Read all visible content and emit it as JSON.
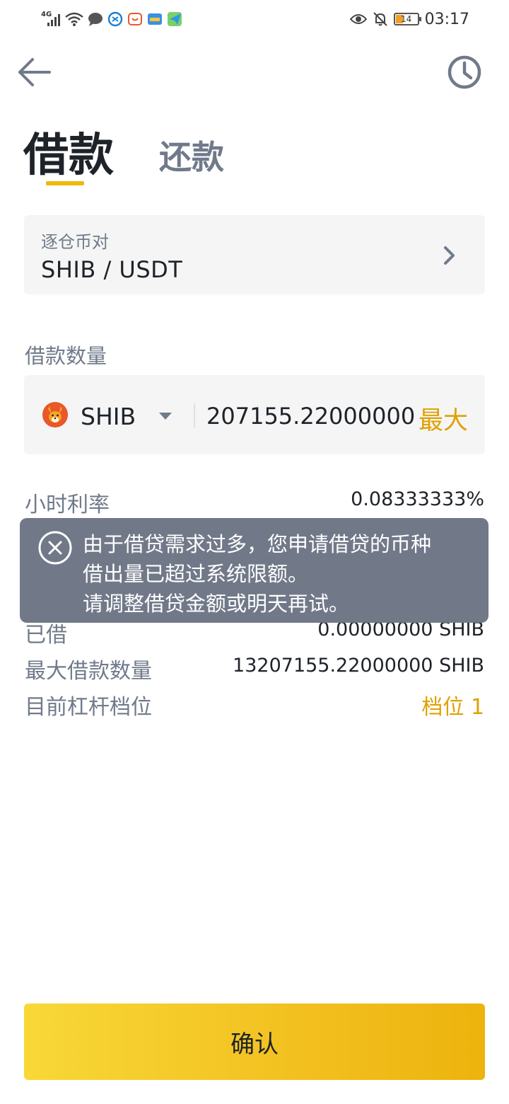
{
  "status_bar": {
    "network": "4G",
    "battery": "14",
    "time": "03:17"
  },
  "tabs": [
    {
      "label": "借款",
      "active": true
    },
    {
      "label": "还款",
      "active": false
    }
  ],
  "pair": {
    "label": "逐仓币对",
    "value": "SHIB / USDT"
  },
  "amount": {
    "label": "借款数量",
    "coin": "SHIB",
    "value": "207155.22000000",
    "max_label": "最大"
  },
  "info": {
    "hourly_rate_label": "小时利率",
    "hourly_rate_value": "0.08333333%",
    "borrowed_label": "已借",
    "borrowed_value": "0.00000000 SHIB",
    "max_borrow_label": "最大借款数量",
    "max_borrow_value": "13207155.22000000 SHIB",
    "leverage_label": "目前杠杆档位",
    "leverage_value": "档位 1"
  },
  "toast": {
    "line1": "由于借贷需求过多，您申请借贷的币种",
    "line2": "借出量已超过系统限额。",
    "line3": "请调整借贷金额或明天再试。"
  },
  "confirm_label": "确认",
  "colors": {
    "accent": "#F0B90B",
    "accent_text": "#E0A100",
    "toast_bg": "#6B7484",
    "card_bg": "#F5F5F5"
  }
}
